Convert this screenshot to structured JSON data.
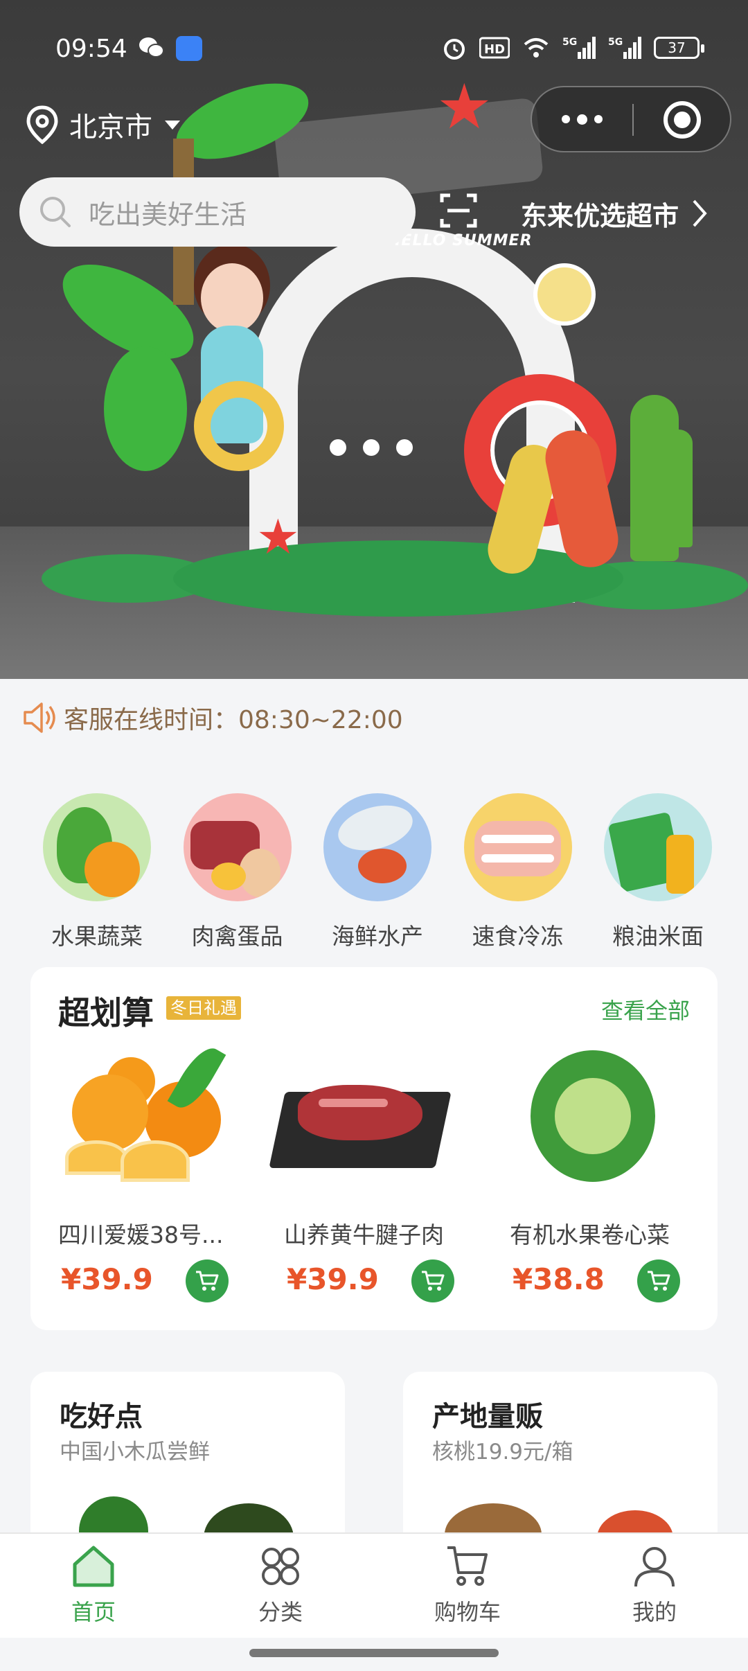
{
  "status_bar": {
    "time": "09:54",
    "battery": "37",
    "network_1": "5G",
    "network_2": "5G",
    "hd_badge": "HD"
  },
  "header": {
    "location": "北京市",
    "search_placeholder": "吃出美好生活",
    "store_name": "东来优选超市"
  },
  "banner": {
    "subtitle": "HELLO SUMMER",
    "slide_count": 3
  },
  "notice": {
    "text": "客服在线时间：08:30~22:00"
  },
  "categories": [
    {
      "label": "水果蔬菜",
      "icon": "vegetables-fruit"
    },
    {
      "label": "肉禽蛋品",
      "icon": "meat-eggs"
    },
    {
      "label": "海鲜水产",
      "icon": "seafood"
    },
    {
      "label": "速食冷冻",
      "icon": "frozen-food"
    },
    {
      "label": "粮油米面",
      "icon": "grain-oil"
    }
  ],
  "deals": {
    "title": "超划算",
    "tag": "冬日礼遇",
    "view_all": "查看全部",
    "products": [
      {
        "name": "四川爱媛38号...",
        "price": "¥39.9",
        "image": "oranges"
      },
      {
        "name": "山养黄牛腱子肉",
        "price": "¥39.9",
        "image": "beef"
      },
      {
        "name": "有机水果卷心菜",
        "price": "¥38.8",
        "image": "cabbage"
      }
    ]
  },
  "promos": [
    {
      "title": "吃好点",
      "subtitle": "中国小木瓜尝鲜"
    },
    {
      "title": "产地量贩",
      "subtitle": "核桃19.9元/箱"
    }
  ],
  "tabbar": {
    "items": [
      {
        "label": "首页",
        "active": true
      },
      {
        "label": "分类",
        "active": false
      },
      {
        "label": "购物车",
        "active": false
      },
      {
        "label": "我的",
        "active": false
      }
    ]
  },
  "colors": {
    "accent_green": "#3aa34c",
    "price_orange": "#e8552a",
    "tag_gold": "#e8b43a"
  }
}
